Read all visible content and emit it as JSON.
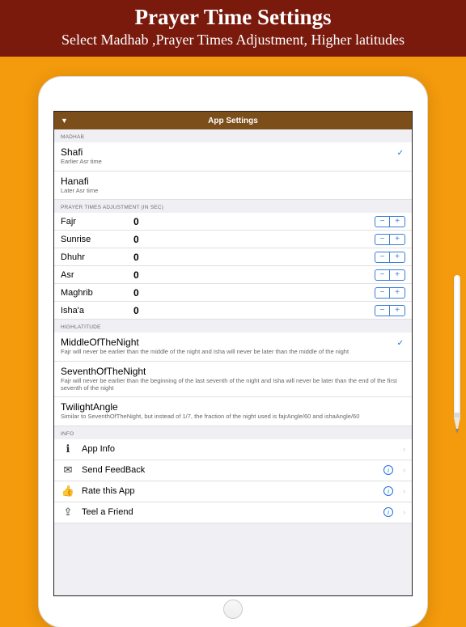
{
  "banner": {
    "title": "Prayer Time Settings",
    "subtitle": "Select Madhab ,Prayer Times Adjustment, Higher latitudes"
  },
  "nav": {
    "title": "App Settings"
  },
  "sections": {
    "madhab_header": "MADHAB",
    "adjust_header": "PRAYER TIMES ADJUSTMENT (IN SEC)",
    "highlat_header": "HIGHLATITUDE",
    "info_header": "INFO"
  },
  "madhab": [
    {
      "name": "Shafi",
      "sub": "Earlier Asr time",
      "selected": true
    },
    {
      "name": "Hanafi",
      "sub": "Later Asr time",
      "selected": false
    }
  ],
  "adjust": [
    {
      "name": "Fajr",
      "value": "0"
    },
    {
      "name": "Sunrise",
      "value": "0"
    },
    {
      "name": "Dhuhr",
      "value": "0"
    },
    {
      "name": "Asr",
      "value": "0"
    },
    {
      "name": "Maghrib",
      "value": "0"
    },
    {
      "name": "Isha'a",
      "value": "0"
    }
  ],
  "highlat": [
    {
      "name": "MiddleOfTheNight",
      "sub": "Fajr will never be earlier than the middle of the night and Isha will never be later than the middle of the night",
      "selected": true
    },
    {
      "name": "SeventhOfTheNight",
      "sub": "Fajr will never be earlier than the beginning of the last seventh of the night and Isha will never be later than the end of the first seventh of the night",
      "selected": false
    },
    {
      "name": "TwilightAngle",
      "sub": "Similar to SeventhOfTheNight, but instead of 1/7, the fraction of the night used is fajrAngle/60 and ishaAngle/60",
      "selected": false
    }
  ],
  "info": [
    {
      "icon": "ℹ",
      "label": "App Info",
      "badge": false
    },
    {
      "icon": "✉",
      "label": "Send FeedBack",
      "badge": true
    },
    {
      "icon": "👍",
      "label": "Rate this App",
      "badge": true
    },
    {
      "icon": "⇪",
      "label": "Teel a Friend",
      "badge": true
    }
  ]
}
